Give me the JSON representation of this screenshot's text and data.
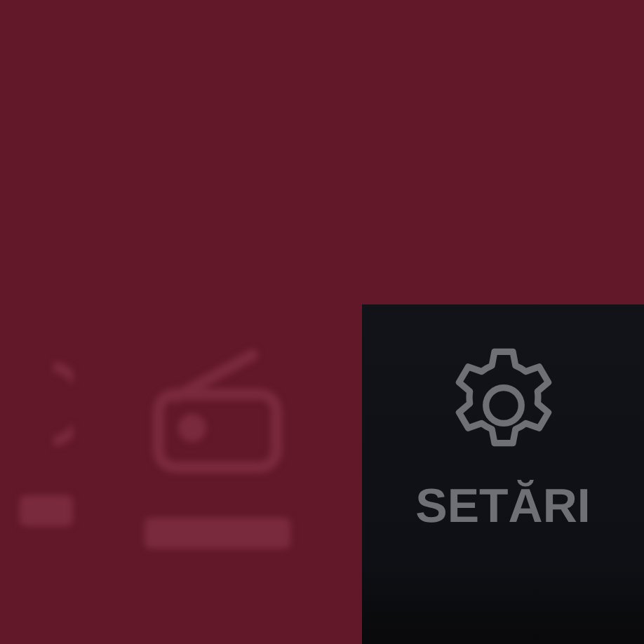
{
  "menu_tiles": [
    {
      "kind": "partial",
      "selected": false
    },
    {
      "kind": "radio",
      "selected": false
    },
    {
      "kind": "settings",
      "label": "SETĂRI",
      "selected": true
    }
  ]
}
